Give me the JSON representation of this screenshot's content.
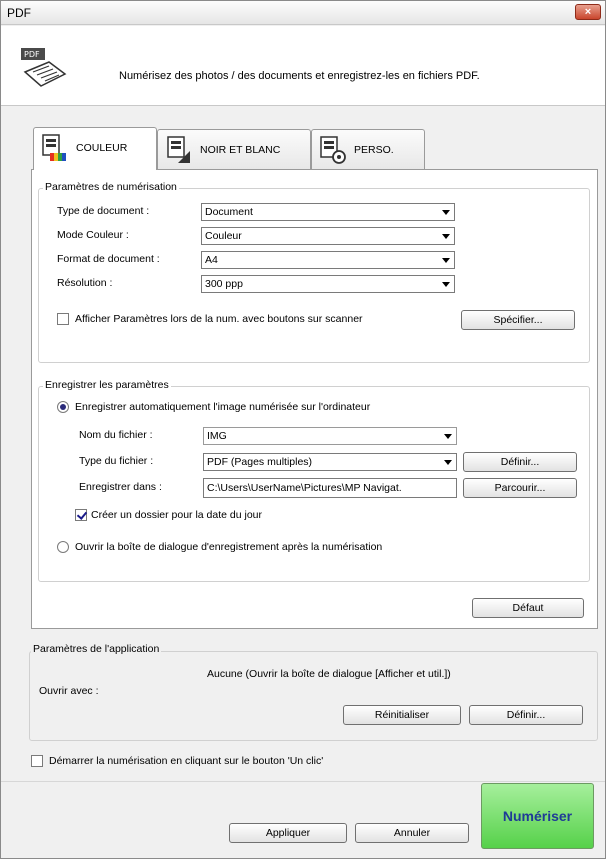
{
  "window": {
    "title": "PDF",
    "close_label": "×"
  },
  "header": {
    "description": "Numérisez des photos / des documents et enregistrez-les en fichiers PDF.",
    "icon": "pdf-scan-icon"
  },
  "tabs": [
    {
      "label": "COULEUR",
      "icon": "color-document-icon",
      "active": true
    },
    {
      "label": "NOIR ET BLANC",
      "icon": "bw-document-icon",
      "active": false
    },
    {
      "label": "PERSO.",
      "icon": "custom-document-icon",
      "active": false
    }
  ],
  "scan_settings": {
    "title": "Paramètres de numérisation",
    "document_type": {
      "label": "Type de document :",
      "value": "Document"
    },
    "color_mode": {
      "label": "Mode Couleur :",
      "value": "Couleur"
    },
    "document_size": {
      "label": "Format de document :",
      "value": "A4"
    },
    "resolution": {
      "label": "Résolution :",
      "value": "300 ppp"
    },
    "show_settings": {
      "label": "Afficher Paramètres lors de la num. avec boutons sur scanner",
      "checked": false
    },
    "specify_button": "Spécifier..."
  },
  "save_settings": {
    "title": "Enregistrer les paramètres",
    "auto_save": {
      "label": "Enregistrer automatiquement l'image numérisée sur l'ordinateur",
      "selected": true
    },
    "file_name": {
      "label": "Nom du fichier :",
      "value": "IMG"
    },
    "file_type": {
      "label": "Type du fichier :",
      "value": "PDF (Pages multiples)"
    },
    "define_button": "Définir...",
    "save_in": {
      "label": "Enregistrer dans :",
      "value": "C:\\Users\\UserName\\Pictures\\MP Navigat."
    },
    "browse_button": "Parcourir...",
    "date_folder": {
      "label": "Créer un dossier pour la date du jour",
      "checked": true
    },
    "open_dialog": {
      "label": "Ouvrir la boîte de dialogue d'enregistrement après la numérisation",
      "selected": false
    }
  },
  "default_button": "Défaut",
  "app_settings": {
    "title": "Paramètres de l'application",
    "open_with_label": "Ouvrir avec :",
    "open_with_value": "Aucune (Ouvrir la boîte de dialogue [Afficher et util.])",
    "reset_button": "Réinitialiser",
    "define_button": "Définir..."
  },
  "one_click": {
    "label": "Démarrer la numérisation en cliquant sur le bouton 'Un clic'",
    "checked": false
  },
  "footer": {
    "apply_button": "Appliquer",
    "cancel_button": "Annuler",
    "scan_button": "Numériser"
  }
}
